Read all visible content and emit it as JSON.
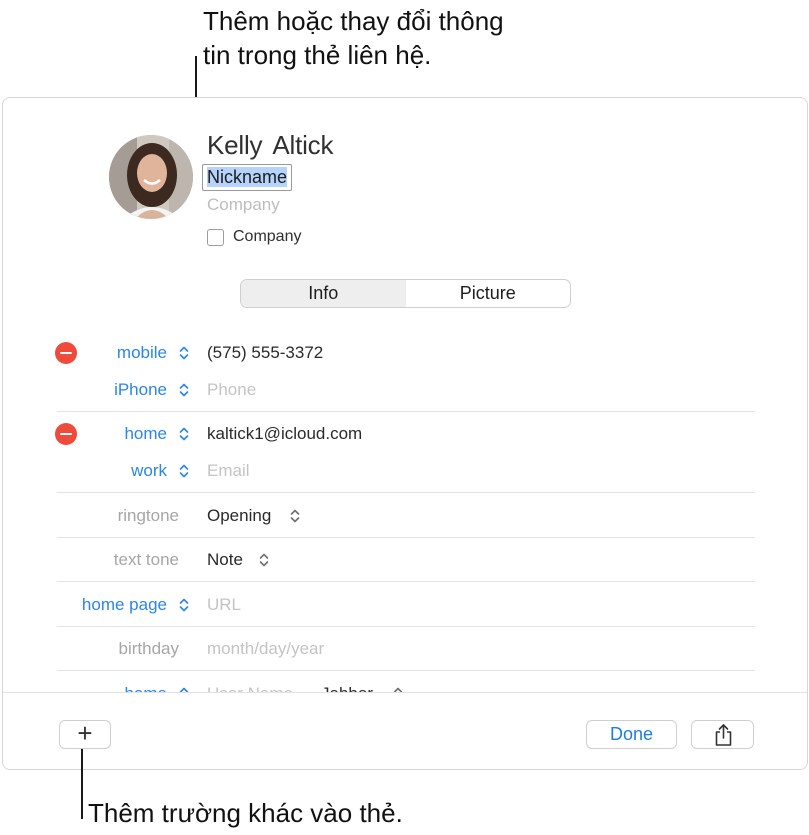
{
  "callouts": {
    "top_line1": "Thêm hoặc thay đổi thông",
    "top_line2": "tin trong thẻ liên hệ.",
    "bottom": "Thêm trường khác vào thẻ."
  },
  "contact": {
    "first_name": "Kelly",
    "last_name": "Altick",
    "nickname": "Nickname",
    "company_placeholder": "Company",
    "company_checkbox_label": "Company"
  },
  "tabs": [
    "Info",
    "Picture"
  ],
  "fields": {
    "phone_label_1": "mobile",
    "phone_value_1": "(575) 555-3372",
    "phone_label_2": "iPhone",
    "phone_placeholder_2": "Phone",
    "email_label_1": "home",
    "email_value_1": "kaltick1@icloud.com",
    "email_label_2": "work",
    "email_placeholder_2": "Email",
    "ringtone_label": "ringtone",
    "ringtone_value": "Opening",
    "texttone_label": "text tone",
    "texttone_value": "Note",
    "homepage_label": "home page",
    "homepage_placeholder": "URL",
    "birthday_label": "birthday",
    "birthday_placeholder": "month/day/year",
    "im_label": "home",
    "im_placeholder": "User Name",
    "im_service": "Jabber"
  },
  "toolbar": {
    "add_label": "+",
    "done_label": "Done"
  },
  "colors": {
    "accent": "#2a86e8",
    "delete": "#f04a3b",
    "selection": "#b5d3fb"
  }
}
